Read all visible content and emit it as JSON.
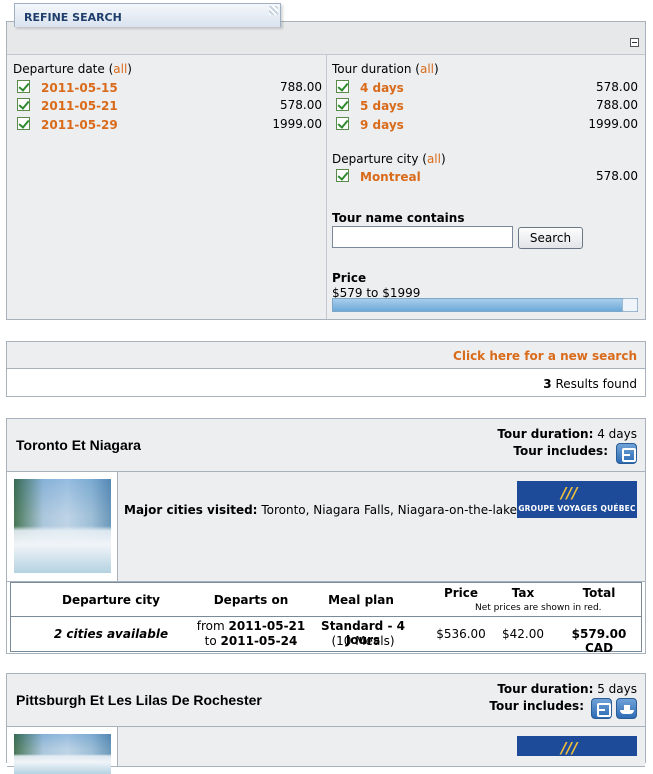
{
  "refine": {
    "tab_label": "REFINE SEARCH",
    "departure_date": {
      "label": "Departure date",
      "all": "all",
      "options": [
        {
          "value": "2011-05-15",
          "price": "788.00"
        },
        {
          "value": "2011-05-21",
          "price": "578.00"
        },
        {
          "value": "2011-05-29",
          "price": "1999.00"
        }
      ]
    },
    "tour_duration": {
      "label": "Tour duration",
      "all": "all",
      "options": [
        {
          "value": "4 days",
          "price": "578.00"
        },
        {
          "value": "5 days",
          "price": "788.00"
        },
        {
          "value": "9 days",
          "price": "1999.00"
        }
      ]
    },
    "departure_city": {
      "label": "Departure city",
      "all": "all",
      "options": [
        {
          "value": "Montreal",
          "price": "578.00"
        }
      ]
    },
    "tour_name": {
      "label": "Tour name contains",
      "value": "",
      "search_button": "Search"
    },
    "price": {
      "label": "Price",
      "range_text": "$579 to $1999",
      "fill_fraction": 1.0
    }
  },
  "results": {
    "new_search_link": "Click here for a new search",
    "count": "3",
    "count_label": "Results found"
  },
  "tours": [
    {
      "title": "Toronto Et Niagara",
      "duration_label": "Tour duration:",
      "duration": "4 days",
      "includes_label": "Tour includes:",
      "includes_icons": [
        "bus-icon"
      ],
      "cities_label": "Major cities visited:",
      "cities": "Toronto, Niagara Falls, Niagara-on-the-lake",
      "logo_text": "GROUPE VOYAGES QUÉBEC",
      "table": {
        "headers": {
          "city": "Departure city",
          "departs": "Departs on",
          "meal": "Meal plan",
          "price": "Price",
          "tax": "Tax",
          "total": "Total",
          "note": "Net prices are shown in red."
        },
        "row": {
          "city": "2 cities available",
          "from_label": "from",
          "from_date": "2011-05-21",
          "to_label": "to",
          "to_date": "2011-05-24",
          "meal_name": "Standard - 4 Jours",
          "meal_count": "(10 Meals)",
          "price": "$536.00",
          "tax": "$42.00",
          "total": "$579.00 CAD"
        }
      }
    },
    {
      "title": "Pittsburgh Et Les Lilas De Rochester",
      "duration_label": "Tour duration:",
      "duration": "5 days",
      "includes_label": "Tour includes:",
      "includes_icons": [
        "bus-icon",
        "ship-icon"
      ]
    }
  ],
  "colors": {
    "link_orange": "#d96b1a",
    "panel_bg": "#eceef0",
    "tab_text": "#1f3e6b",
    "icon_blue": "#2d6cb5",
    "logo_blue": "#1d4b9a"
  }
}
